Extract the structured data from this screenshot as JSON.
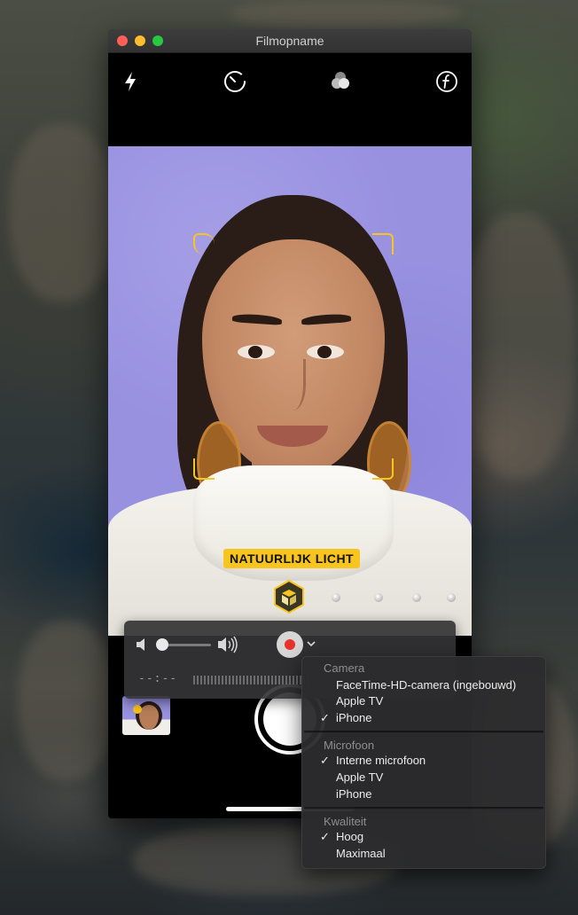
{
  "window": {
    "title": "Filmopname"
  },
  "camera_toolbar": {
    "icons": [
      "flash-icon",
      "timer-icon",
      "filters-icon",
      "aperture-icon"
    ]
  },
  "preview": {
    "lighting_mode": "NATUURLIJK LICHT"
  },
  "recording_panel": {
    "timecode": "--:--"
  },
  "menu": {
    "camera": {
      "header": "Camera",
      "items": [
        {
          "label": "FaceTime-HD-camera (ingebouwd)",
          "checked": false
        },
        {
          "label": "Apple TV",
          "checked": false
        },
        {
          "label": "iPhone",
          "checked": true
        }
      ]
    },
    "microphone": {
      "header": "Microfoon",
      "items": [
        {
          "label": "Interne microfoon",
          "checked": true
        },
        {
          "label": "Apple TV",
          "checked": false
        },
        {
          "label": "iPhone",
          "checked": false
        }
      ]
    },
    "quality": {
      "header": "Kwaliteit",
      "items": [
        {
          "label": "Hoog",
          "checked": true
        },
        {
          "label": "Maximaal",
          "checked": false
        }
      ]
    },
    "check_mark": "✓"
  },
  "colors": {
    "accent_yellow": "#f7c51d",
    "record_red": "#e8332c",
    "preview_background": "#9891e0"
  }
}
